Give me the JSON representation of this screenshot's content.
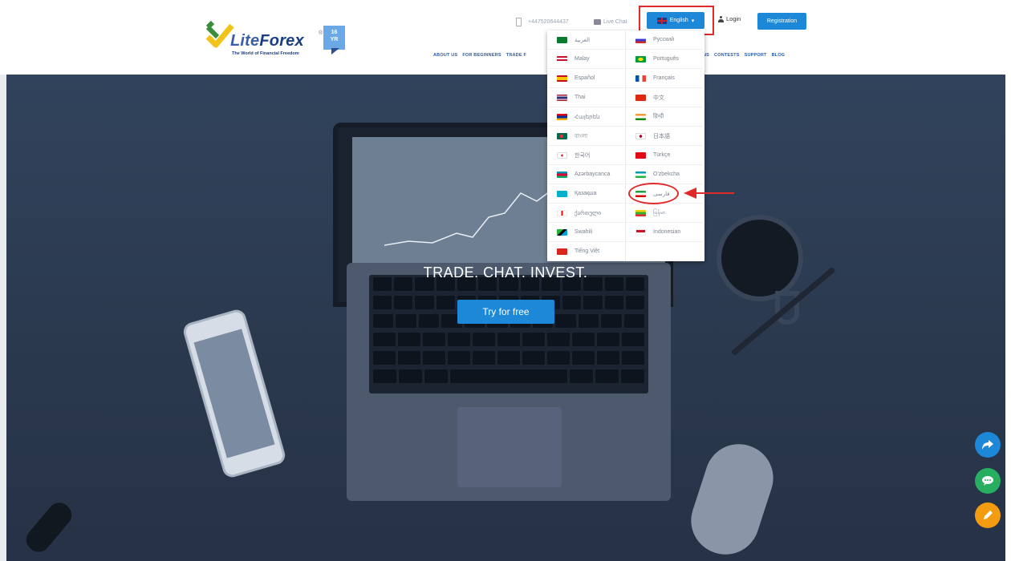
{
  "header": {
    "logo": {
      "word_lite": "Lite",
      "word_forex": "Forex",
      "reg": "®",
      "tagline": "The World of Financial Freedom",
      "badge_years": "16",
      "badge_unit": "YR"
    },
    "phone": "+447520644437",
    "live_chat": "Live Chat",
    "language_button": "English",
    "login": "Login",
    "registration": "Registration",
    "nav_left": [
      "ABOUT US",
      "FOR BEGINNERS",
      "TRADE F"
    ],
    "nav_right": [
      "NS",
      "CONTESTS",
      "SUPPORT",
      "BLOG"
    ]
  },
  "languages": {
    "left": [
      "العربية",
      "Malay",
      "Español",
      "Thai",
      "Հայերեն",
      "বাংলা",
      "한국어",
      "Azərbaycanca",
      "Қазақша",
      "ქართული",
      "Swahili",
      "Tiếng Việt"
    ],
    "right": [
      "Русский",
      "Português",
      "Français",
      "中文",
      "हिन्दी",
      "日本語",
      "Türkçe",
      "O'zbekcha",
      "فارسی",
      "မြန်မာ",
      "Indonesian"
    ]
  },
  "flag_colors": {
    "left": [
      "#0a7a2f",
      "#c8102e",
      "#c60b1e",
      "#2d2a7a",
      "#d90012",
      "#006a4e",
      "#ffffff",
      "#0092bc",
      "#00afca",
      "#ff0000",
      "#1eb53a",
      "#da251d"
    ],
    "right": [
      "#3a3ad0",
      "#009c3b",
      "#0055a4",
      "#de2910",
      "#ff9933",
      "#ffffff",
      "#e30a17",
      "#1eb53a",
      "#239f40",
      "#fecb00",
      "#ce1126"
    ]
  },
  "hero": {
    "title": "TRADE. CHAT. INVEST.",
    "cta": "Try for free"
  },
  "colors": {
    "accent": "#1e88d8",
    "annotation": "#e02a2a",
    "share_fab": "#1e88d8",
    "chat_fab": "#27ae60",
    "edit_fab": "#f39c12"
  }
}
